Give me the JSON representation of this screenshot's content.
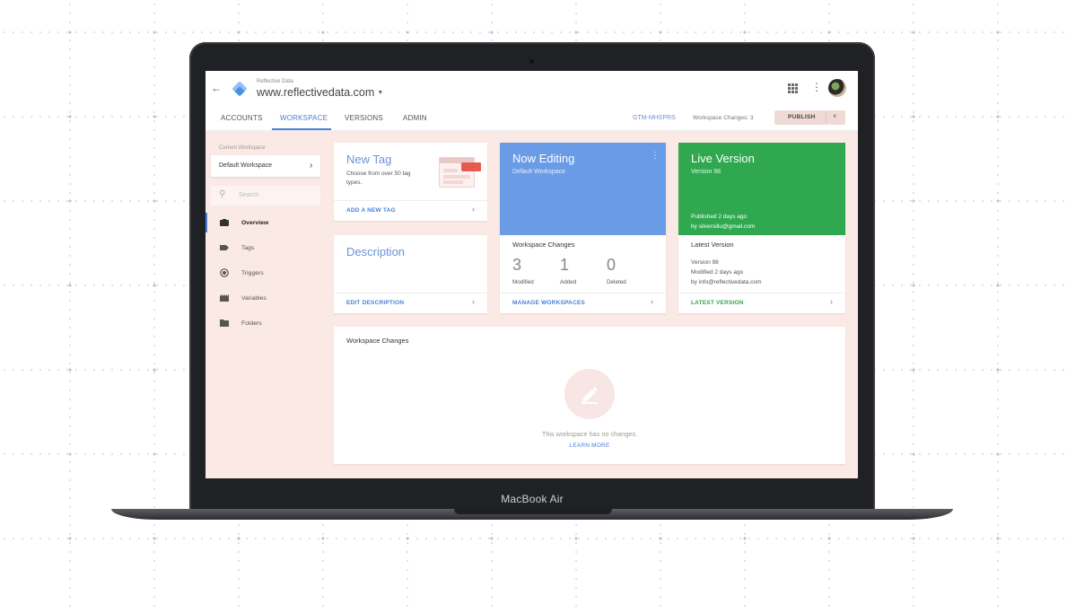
{
  "device": {
    "label": "MacBook Air"
  },
  "header": {
    "account": "Reflective Data",
    "container": "www.reflectivedata.com",
    "icons": {
      "back": "back-arrow-icon",
      "apps": "apps-grid-icon",
      "more": "more-vert-icon",
      "logo": "gtm-logo-icon"
    }
  },
  "tabs": [
    {
      "label": "ACCOUNTS",
      "active": false
    },
    {
      "label": "WORKSPACE",
      "active": true
    },
    {
      "label": "VERSIONS",
      "active": false
    },
    {
      "label": "ADMIN",
      "active": false
    }
  ],
  "toolbar": {
    "container_id": "GTM-MHSPRS",
    "workspace_changes": "Workspace Changes: 3",
    "publish_label": "PUBLISH"
  },
  "sidebar": {
    "current_workspace_label": "Current Workspace",
    "workspace_name": "Default Workspace",
    "search_placeholder": "Search",
    "items": [
      {
        "label": "Overview",
        "icon": "briefcase-icon",
        "active": true
      },
      {
        "label": "Tags",
        "icon": "tag-icon",
        "active": false
      },
      {
        "label": "Triggers",
        "icon": "trigger-icon",
        "active": false
      },
      {
        "label": "Variables",
        "icon": "variables-icon",
        "active": false
      },
      {
        "label": "Folders",
        "icon": "folder-icon",
        "active": false
      }
    ]
  },
  "new_tag": {
    "title": "New Tag",
    "description": "Choose from over 50 tag types.",
    "link": "ADD A NEW TAG"
  },
  "description_card": {
    "title": "Description",
    "link": "EDIT DESCRIPTION"
  },
  "now_editing": {
    "title": "Now Editing",
    "workspace": "Default Workspace",
    "changes_label": "Workspace Changes",
    "stats": [
      {
        "value": "3",
        "label": "Modified"
      },
      {
        "value": "1",
        "label": "Added"
      },
      {
        "value": "0",
        "label": "Deleted"
      }
    ],
    "link": "MANAGE WORKSPACES"
  },
  "live_version": {
    "title": "Live Version",
    "version": "Version 98",
    "published": "Published 2 days ago",
    "published_by": "by silversillu@gmail.com",
    "latest_label": "Latest Version",
    "latest_version": "Version 98",
    "latest_modified": "Modified 2 days ago",
    "latest_by": "by info@reflectivedata.com",
    "link": "LATEST VERSION"
  },
  "workspace_changes_panel": {
    "title": "Workspace Changes",
    "empty_message": "This workspace has no changes.",
    "learn_more": "LEARN MORE"
  },
  "colors": {
    "accent_blue": "#4a80d6",
    "editing_blue": "#6a9be6",
    "live_green": "#2fa84f",
    "screen_bg": "#fbe9e6"
  }
}
